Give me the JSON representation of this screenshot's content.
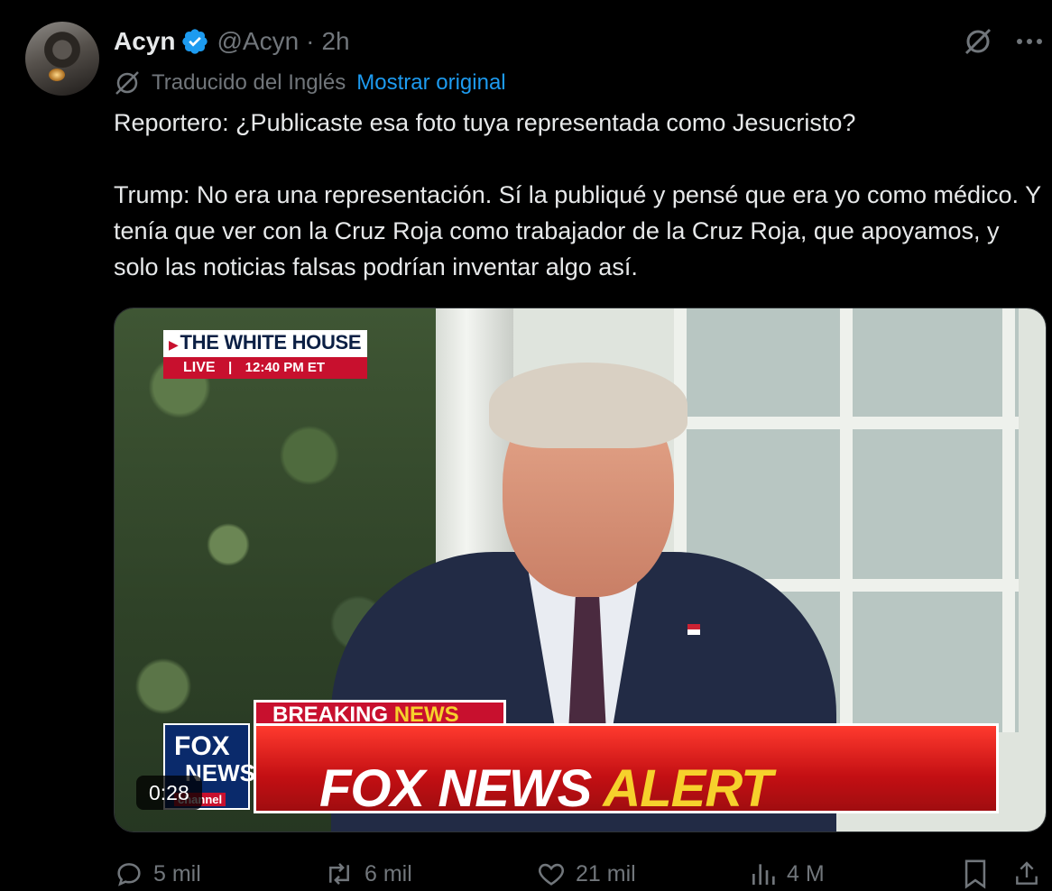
{
  "author": {
    "name": "Acyn",
    "handle": "@Acyn",
    "separator": "·",
    "time": "2h"
  },
  "translation": {
    "label": "Traducido del Inglés",
    "show_original": "Mostrar original"
  },
  "tweet": {
    "paragraph1": "Reportero: ¿Publicaste esa foto tuya representada como Jesucristo?",
    "paragraph2": "Trump: No era una representación. Sí la publiqué y pensé que era yo como médico. Y tenía que ver con la Cruz Roja como trabajador de la Cruz Roja, que apoyamos, y solo las noticias falsas podrían inventar algo así."
  },
  "video": {
    "duration": "0:28",
    "banner_title": "THE WHITE HOUSE",
    "banner_live": "LIVE",
    "banner_sep": "|",
    "banner_time": "12:40 PM ET",
    "breaking_1": "BREAKING",
    "breaking_2": "NEWS",
    "alert_1": "FOX NEWS",
    "alert_2": "ALERT",
    "logo_line1": "FOX",
    "logo_line2": "NEWS",
    "logo_line3": "channel"
  },
  "actions": {
    "replies": "5 mil",
    "reposts": "6 mil",
    "likes": "21 mil",
    "views": "4 M"
  },
  "icons": {
    "verified": "verified-badge-icon",
    "grok": "grok-icon",
    "more": "more-icon",
    "translate": "translate-icon",
    "reply": "reply-icon",
    "repost": "repost-icon",
    "like": "heart-icon",
    "views": "views-icon",
    "bookmark": "bookmark-icon",
    "share": "share-icon"
  },
  "colors": {
    "background": "#000000",
    "text": "#e7e9ea",
    "muted": "#71767b",
    "accent": "#1d9bf0"
  }
}
